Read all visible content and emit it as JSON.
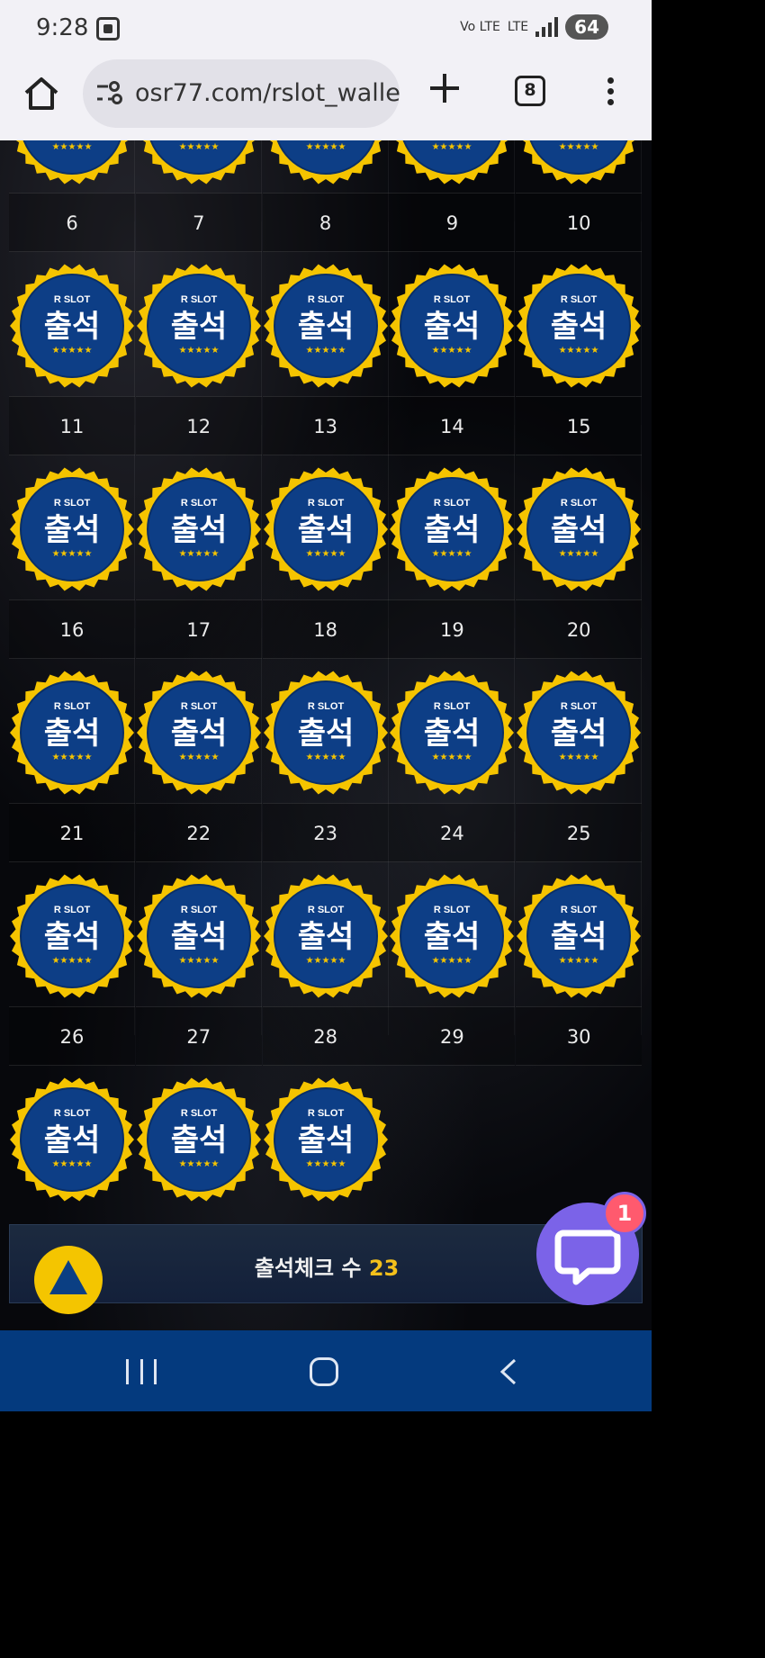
{
  "status": {
    "time": "9:28",
    "network_left": "Vo LTE",
    "network_right": "LTE",
    "battery": "64"
  },
  "browser": {
    "url": "osr77.com/rslot_walle",
    "tab_count": "8"
  },
  "badge": {
    "brand": "R SLOT",
    "label": "출석",
    "stars": "★★★★★"
  },
  "calendar": {
    "rows": [
      {
        "days": [
          "6",
          "7",
          "8",
          "9",
          "10"
        ],
        "stamped": [
          true,
          true,
          true,
          true,
          true
        ]
      },
      {
        "days": [
          "11",
          "12",
          "13",
          "14",
          "15"
        ],
        "stamped": [
          true,
          true,
          true,
          true,
          true
        ]
      },
      {
        "days": [
          "16",
          "17",
          "18",
          "19",
          "20"
        ],
        "stamped": [
          true,
          true,
          true,
          true,
          true
        ]
      },
      {
        "days": [
          "21",
          "22",
          "23",
          "24",
          "25"
        ],
        "stamped": [
          true,
          true,
          true,
          true,
          true
        ]
      },
      {
        "days": [
          "26",
          "27",
          "28",
          "29",
          "30"
        ],
        "stamped": [
          true,
          true,
          true,
          false,
          false
        ]
      }
    ]
  },
  "footer": {
    "label": "출석체크 수",
    "count": "23"
  },
  "chat": {
    "badge_count": "1"
  },
  "colors": {
    "badge_ring": "#f5c400",
    "badge_fill": "#0d3e86",
    "accent": "#f4c01b",
    "chat": "#7b63e8"
  }
}
